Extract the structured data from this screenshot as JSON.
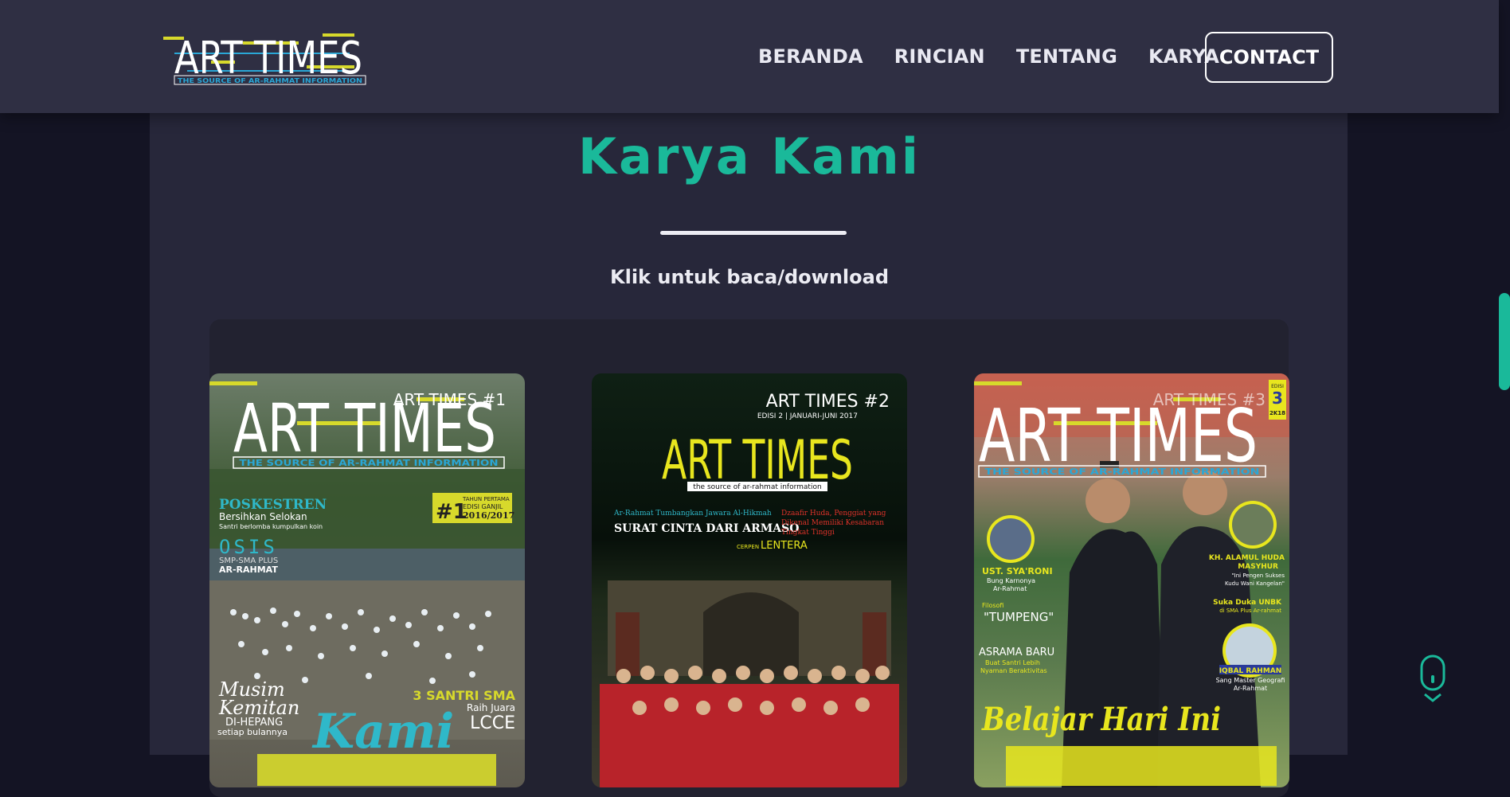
{
  "navbar": {
    "logo": {
      "title": "ART TIMES",
      "tagline": "THE SOURCE OF AR-RAHMAT INFORMATION"
    },
    "links": [
      {
        "label": "BERANDA"
      },
      {
        "label": "RINCIAN"
      },
      {
        "label": "TENTANG"
      },
      {
        "label": "KARYA"
      }
    ],
    "contact_label": "CONTACT"
  },
  "section": {
    "title": "Karya Kami",
    "subtitle": "Klik untuk baca/download"
  },
  "covers": [
    {
      "edition": "ART TIMES #1",
      "masthead": "ART TIMES",
      "tagline": "THE SOURCE OF AR-RAHMAT INFORMATION",
      "badge": "#1",
      "badge_line1": "TAHUN PERTAMA",
      "badge_line2": "EDISI GANJIL",
      "badge_line3": "2016/2017",
      "headline1": "POSKESTREN",
      "headline1_sub": "Bersihkan Selokan",
      "headline1_sub2": "Santri berlomba kumpulkan koin",
      "headline2": "OSIS",
      "headline2_sub": "SMP-SMA PLUS",
      "headline2_sub2": "AR-RAHMAT",
      "bottom_left1": "Musim",
      "bottom_left2": "Kemitan",
      "bottom_left3": "DI-HEPANG",
      "bottom_left4": "setiap bulannya",
      "bottom_right1": "3 SANTRI SMA",
      "bottom_right2": "Raih Juara",
      "bottom_right3": "LCCE",
      "bottom_title": "Kami"
    },
    {
      "edition": "ART TIMES #2",
      "edition_sub": "EDISI 2 | JANUARI-JUNI 2017",
      "masthead": "ART TIMES",
      "tagline": "the source of ar-rahmat information",
      "left1": "Ar-Rahmat Tumbangkan Jawara Al-Hikmah",
      "left2": "SURAT CINTA DARI ARMASO",
      "right1": "Dzaafir Huda, Penggiat yang",
      "right2": "Dikenal Memiliki Kesabaran",
      "right3": "Tingkat Tinggi",
      "cerpen": "CERPEN",
      "cerpen_title": "LENTERA"
    },
    {
      "edition": "ART TIMES #3",
      "masthead": "ART TIMES",
      "tagline": "THE SOURCE OF AR-RAHMAT INFORMATION",
      "badge_top": "EDISI",
      "badge_num": "3",
      "badge_year": "2K18",
      "person1_name": "UST. SYA'RONI",
      "person1_sub": "Bung Karnonya",
      "person1_sub2": "Ar-Rahmat",
      "person2_name": "KH. ALAMUL HUDA",
      "person2_name2": "MASYHUR",
      "person2_sub": "\"Ini Pengen Sukses",
      "person2_sub2": "Kudu Wani Kangelan\"",
      "filosofi": "Filosofi",
      "tumpeng": "\"TUMPENG\"",
      "asrama": "ASRAMA BARU",
      "asrama_sub": "Buat Santri Lebih",
      "asrama_sub2": "Nyaman Beraktivitas",
      "right_mid": "Suka Duka UNBK",
      "right_mid2": "di SMA Plus Ar-rahmat",
      "person3_name": "IQBAL RAHMAN",
      "person3_sub": "Sang Master Geografi",
      "person3_sub2": "Ar-Rahmat",
      "bottom_title": "Belajar Hari Ini"
    }
  ],
  "colors": {
    "accent": "#1ab99a",
    "navbar": "#2f2f43",
    "panel": "#27273a",
    "background": "#141424",
    "gallery": "#222230"
  }
}
